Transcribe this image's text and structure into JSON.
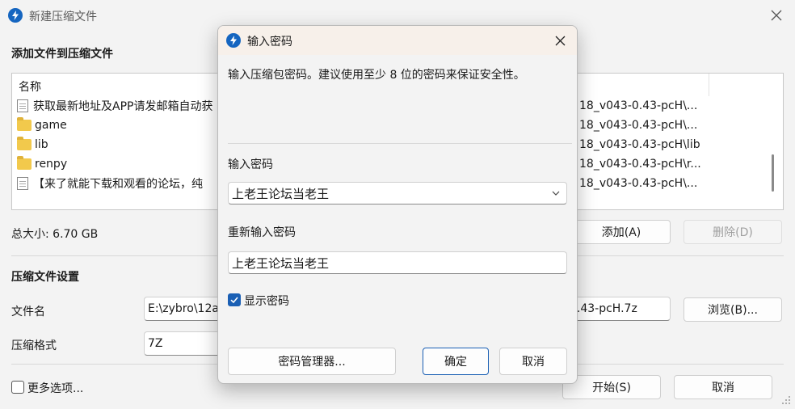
{
  "window": {
    "title": "新建压缩文件",
    "section_add": "添加文件到压缩文件",
    "list_header": "名称",
    "files": [
      {
        "name": "获取最新地址及APP请发邮箱自动获",
        "type": "file",
        "path": "18_v043-0.43-pcH\\..."
      },
      {
        "name": "game",
        "type": "folder",
        "path": "18_v043-0.43-pcH\\..."
      },
      {
        "name": "lib",
        "type": "folder",
        "path": "18_v043-0.43-pcH\\lib"
      },
      {
        "name": "renpy",
        "type": "folder",
        "path": "18_v043-0.43-pcH\\r..."
      },
      {
        "name": "【来了就能下载和观看的论坛，纯",
        "type": "file",
        "path": "18_v043-0.43-pcH\\..."
      }
    ],
    "total_size": "总大小: 6.70 GB",
    "add_button": "添加(A)",
    "delete_button": "删除(D)",
    "section_settings": "压缩文件设置",
    "filename_label": "文件名",
    "filename_value_left": "E:\\zybro\\12a",
    "filename_value_right": "0.43-pcH.7z",
    "browse_button": "浏览(B)...",
    "format_label": "压缩格式",
    "format_value": "7Z",
    "more_options": "更多选项...",
    "start_button": "开始(S)",
    "cancel_button": "取消"
  },
  "dialog": {
    "title": "输入密码",
    "description": "输入压缩包密码。建议使用至少 8 位的密码来保证安全性。",
    "password_label": "输入密码",
    "password_value": "上老王论坛当老王",
    "confirm_label": "重新输入密码",
    "confirm_value": "上老王论坛当老王",
    "show_password": "显示密码",
    "show_password_checked": true,
    "manager_button": "密码管理器...",
    "ok_button": "确定",
    "cancel_button": "取消"
  },
  "colors": {
    "accent": "#1a5fb4",
    "dialog_titlebar": "#f7f0ea"
  }
}
